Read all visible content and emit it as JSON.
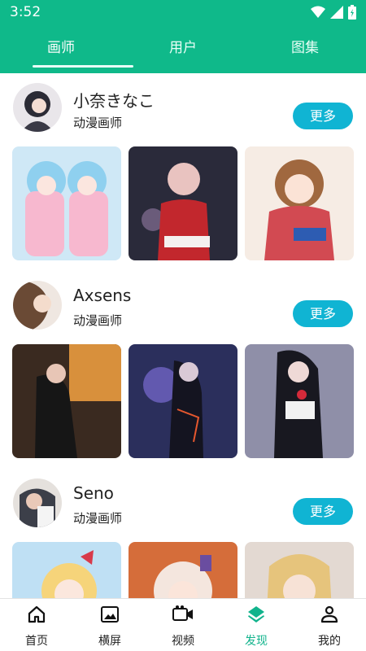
{
  "status": {
    "time": "3:52"
  },
  "tabs": [
    {
      "label": "画师"
    },
    {
      "label": "用户"
    },
    {
      "label": "图集"
    }
  ],
  "artists": [
    {
      "name": "小奈きなこ",
      "role": "动漫画师",
      "more": "更多"
    },
    {
      "name": "Axsens",
      "role": "动漫画师",
      "more": "更多"
    },
    {
      "name": "Seno",
      "role": "动漫画师",
      "more": "更多"
    }
  ],
  "nav": [
    {
      "label": "首页",
      "icon": "home-icon"
    },
    {
      "label": "横屏",
      "icon": "image-icon"
    },
    {
      "label": "视频",
      "icon": "video-icon"
    },
    {
      "label": "发现",
      "icon": "layers-icon"
    },
    {
      "label": "我的",
      "icon": "person-icon"
    }
  ],
  "colors": {
    "header": "#0fb98a",
    "more_button": "#10b4d3",
    "nav_active": "#11b38c"
  }
}
